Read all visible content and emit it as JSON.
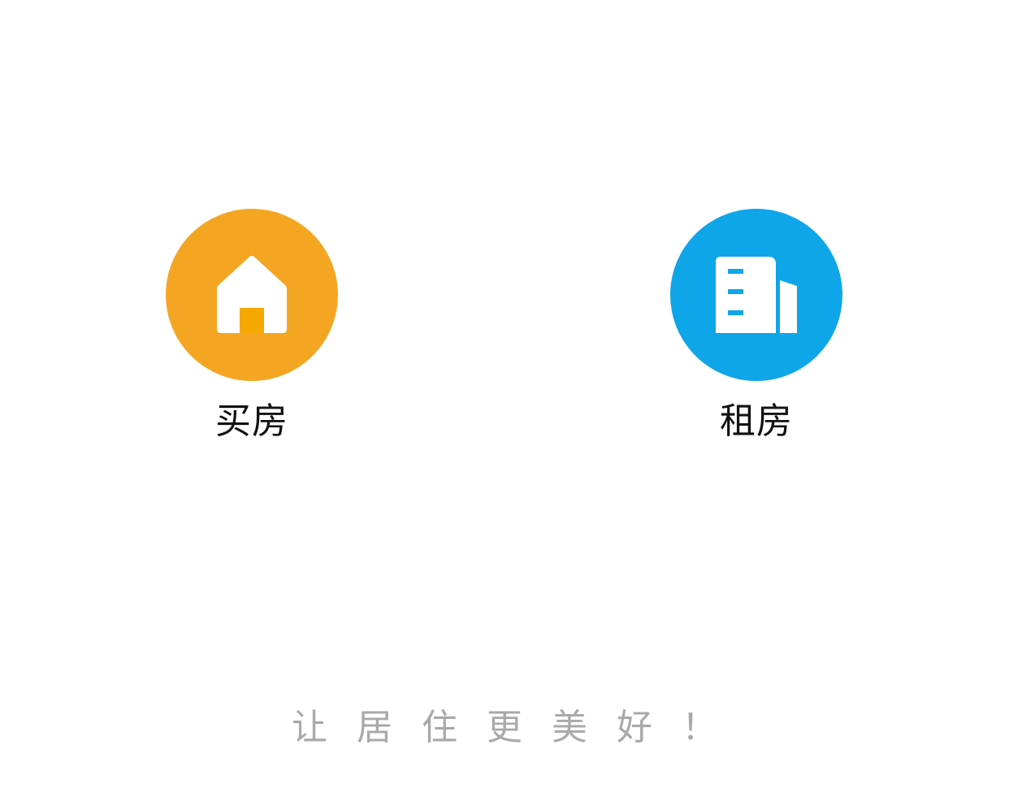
{
  "options": {
    "buy": {
      "label": "买房",
      "icon": "house-icon",
      "color": "#F4A623"
    },
    "rent": {
      "label": "租房",
      "icon": "building-icon",
      "color": "#0EA5E9"
    }
  },
  "slogan": "让居住更美好！"
}
